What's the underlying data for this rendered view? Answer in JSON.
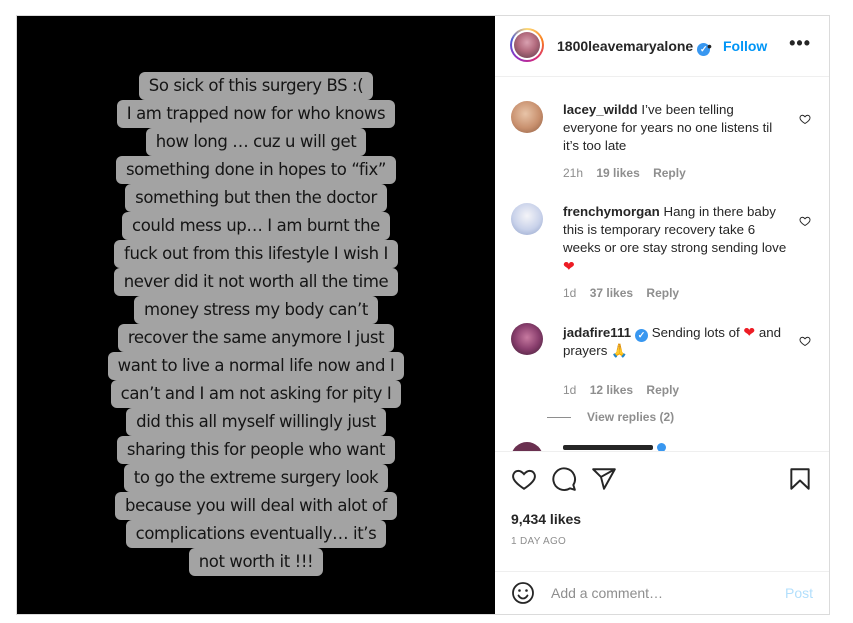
{
  "post": {
    "username": "1800leavemaryalone",
    "separator": "•",
    "follow_label": "Follow",
    "more_label": "•••"
  },
  "story_text": [
    "So sick of this surgery BS :(",
    "I am trapped now for who knows",
    "how long … cuz u will get",
    "something done in hopes to “fix”",
    "something but then the doctor",
    "could mess up… I am burnt the",
    "fuck out from this lifestyle I wish I",
    "never did it not worth all the time",
    "money stress my body can’t",
    "recover the same anymore I just",
    "want to live a normal life now and I",
    "can’t and I am not asking for pity I",
    "did this all myself willingly just",
    "sharing this for people who want",
    "to go the extreme surgery look",
    "because you will deal with alot of",
    "complications eventually… it’s",
    "not worth it !!!"
  ],
  "comments": [
    {
      "user": "lacey_wildd",
      "text": "I’ve been telling everyone for years no one listens til it’s too late",
      "time": "21h",
      "likes": "19 likes",
      "reply": "Reply"
    },
    {
      "user": "frenchymorgan",
      "text": "Hang in there baby this is temporary recovery take 6 weeks or ore stay strong sending love",
      "emoji": "❤",
      "time": "1d",
      "likes": "37 likes",
      "reply": "Reply"
    },
    {
      "user": "jadafire111",
      "text_a": "Sending lots of",
      "emoji_a": "❤",
      "text_b": "and prayers",
      "emoji_b": "🙏",
      "time": "1d",
      "likes": "12 likes",
      "reply": "Reply"
    }
  ],
  "view_replies": "View replies (2)",
  "likes_count": "9,434 likes",
  "posted_time": "1 DAY AGO",
  "add_comment": {
    "placeholder": "Add a comment…",
    "post_label": "Post"
  },
  "colors": {
    "link_blue": "#0095f6",
    "verified_blue": "#3897f0",
    "muted_gray": "#8e8e8e",
    "heart_red": "#ed1c24"
  },
  "icons": [
    "heart-icon",
    "comment-icon",
    "share-icon",
    "bookmark-icon",
    "emoji-icon",
    "verified-badge-icon",
    "more-options-icon"
  ]
}
